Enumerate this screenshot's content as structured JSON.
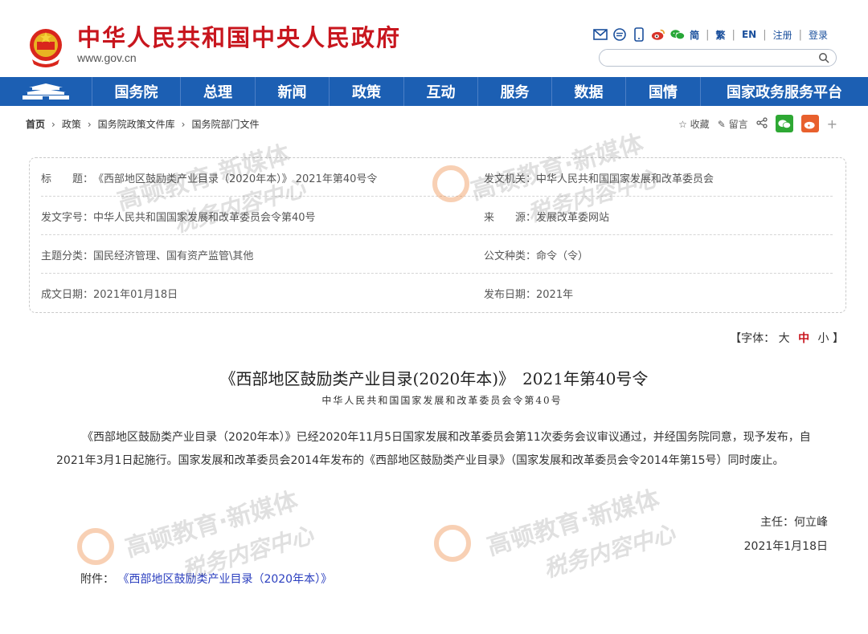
{
  "header": {
    "title": "中华人民共和国中央人民政府",
    "url": "www.gov.cn",
    "lang_simplified": "简",
    "lang_traditional": "繁",
    "lang_en": "EN",
    "register": "注册",
    "login": "登录",
    "search_placeholder": ""
  },
  "nav": {
    "items": [
      "国务院",
      "总理",
      "新闻",
      "政策",
      "互动",
      "服务",
      "数据",
      "国情",
      "国家政务服务平台"
    ]
  },
  "breadcrumb": [
    "首页",
    "政策",
    "国务院政策文件库",
    "国务院部门文件"
  ],
  "actions": {
    "favorite": "收藏",
    "comment": "留言"
  },
  "info": {
    "title_label": "标　　题：",
    "title_value": "《西部地区鼓励类产业目录（2020年本）》 2021年第40号令",
    "issuer_label": "发文机关：",
    "issuer_value": "中华人民共和国国家发展和改革委员会",
    "docno_label": "发文字号：",
    "docno_value": "中华人民共和国国家发展和改革委员会令第40号",
    "source_label": "来　　源：",
    "source_value": "发展改革委网站",
    "topic_label": "主题分类：",
    "topic_value": "国民经济管理、国有资产监管\\其他",
    "genre_label": "公文种类：",
    "genre_value": "命令（令）",
    "date_label": "成文日期：",
    "date_value": "2021年01月18日",
    "pub_label": "发布日期：",
    "pub_value": "2021年"
  },
  "fontsize": {
    "prefix": "【字体：",
    "large": "大",
    "medium": "中",
    "small": "小",
    "suffix": "】"
  },
  "document": {
    "title": "《西部地区鼓励类产业目录(2020年本)》　2021年第40号令",
    "subtitle": "中华人民共和国国家发展和改革委员会令第40号",
    "body": "《西部地区鼓励类产业目录（2020年本）》已经2020年11月5日国家发展和改革委员会第11次委务会议审议通过，并经国务院同意，现予发布，自2021年3月1日起施行。国家发展和改革委员会2014年发布的《西部地区鼓励类产业目录》（国家发展和改革委员会令2014年第15号）同时废止。",
    "sign_name": "主任：何立峰",
    "sign_date": "2021年1月18日",
    "attach_label": "附件：",
    "attach_link": "《西部地区鼓励类产业目录（2020年本）》"
  },
  "watermark": {
    "line1": "高顿教育·新媒体",
    "line2": "税务内容中心"
  },
  "colors": {
    "brand_red": "#c8161e",
    "nav_blue": "#1c5fb3",
    "link_blue": "#2b3fbf"
  }
}
